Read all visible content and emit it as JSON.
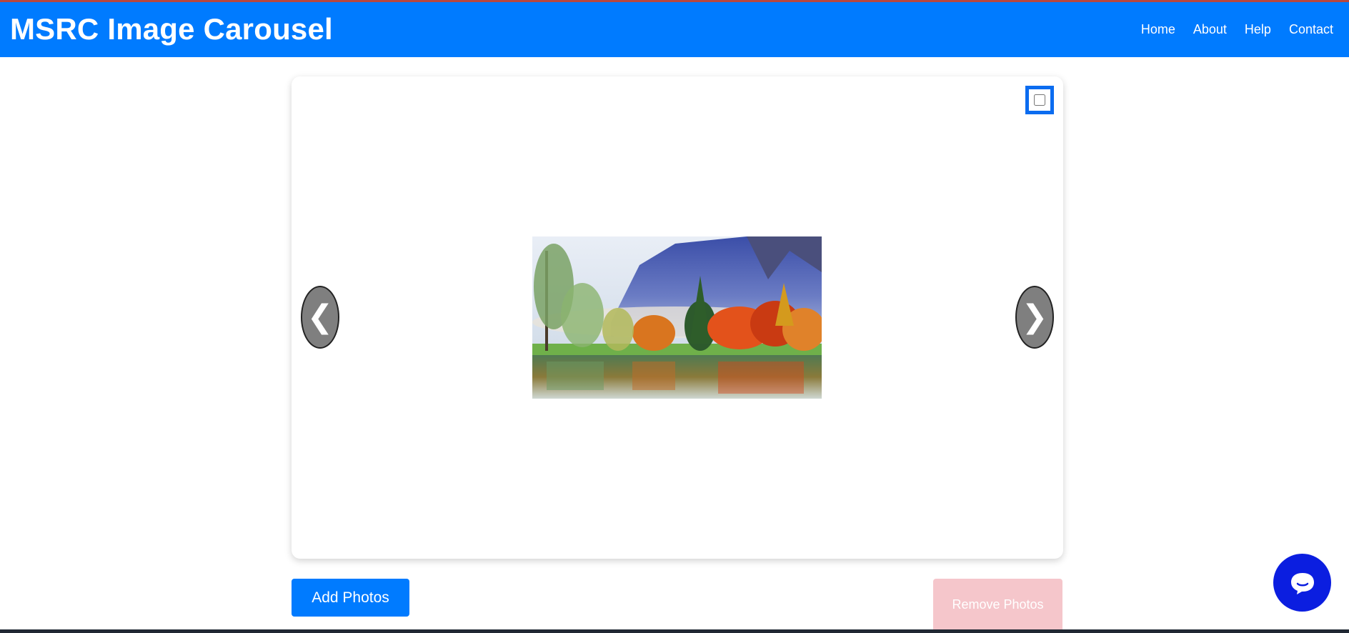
{
  "header": {
    "title": "MSRC Image Carousel",
    "nav": [
      "Home",
      "About",
      "Help",
      "Contact"
    ]
  },
  "carousel": {
    "prev_label": "❮",
    "next_label": "❯",
    "select_checkbox_checked": false,
    "image_icon": "landscape-photo-icon"
  },
  "actions": {
    "add_label": "Add Photos",
    "remove_label": "Remove Photos"
  },
  "chat": {
    "icon": "chat-bubble-icon"
  },
  "colors": {
    "brand": "#007bff",
    "remove_disabled": "#f5c6cb",
    "chat": "#0b1ee0"
  }
}
